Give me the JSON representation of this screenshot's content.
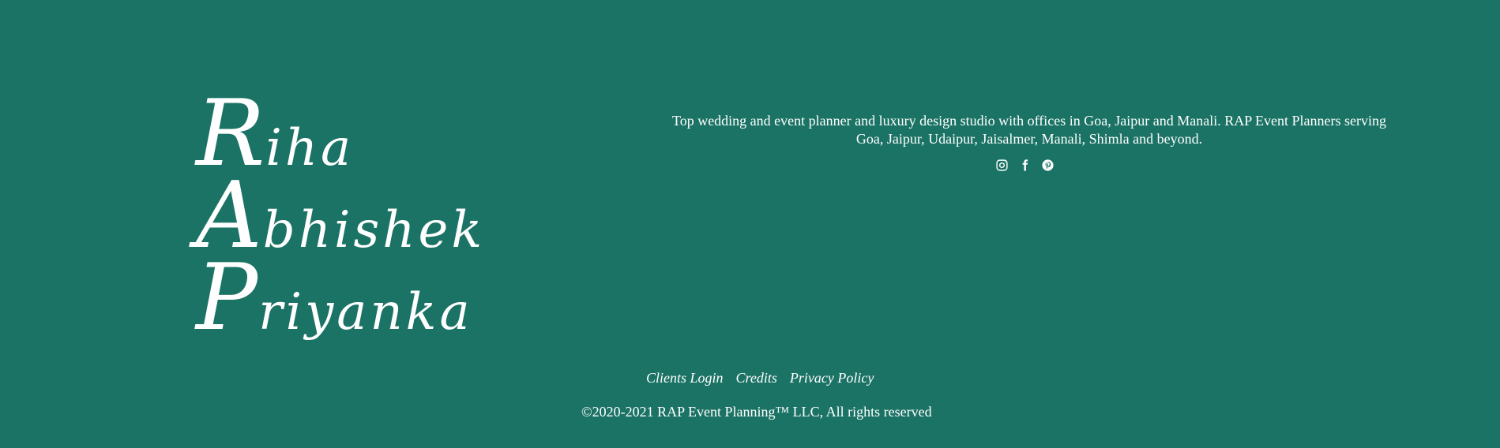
{
  "logo": {
    "lines": [
      {
        "first": "R",
        "rest": "iha"
      },
      {
        "first": "A",
        "rest": "bhishek"
      },
      {
        "first": "P",
        "rest": "riyanka"
      }
    ]
  },
  "description": "Top wedding and event planner and luxury design studio with offices in Goa, Jaipur and Manali. RAP Event Planners serving Goa, Jaipur, Udaipur, Jaisalmer, Manali, Shimla and beyond.",
  "social": {
    "icons": [
      "instagram-icon",
      "facebook-icon",
      "pinterest-icon"
    ]
  },
  "links": {
    "clients_login": "Clients Login",
    "credits": "Credits",
    "privacy_policy": "Privacy Policy"
  },
  "copyright": "©2020-2021 RAP Event Planning™ LLC, All rights reserved",
  "colors": {
    "background": "#1b7365",
    "text": "#ffffff"
  }
}
